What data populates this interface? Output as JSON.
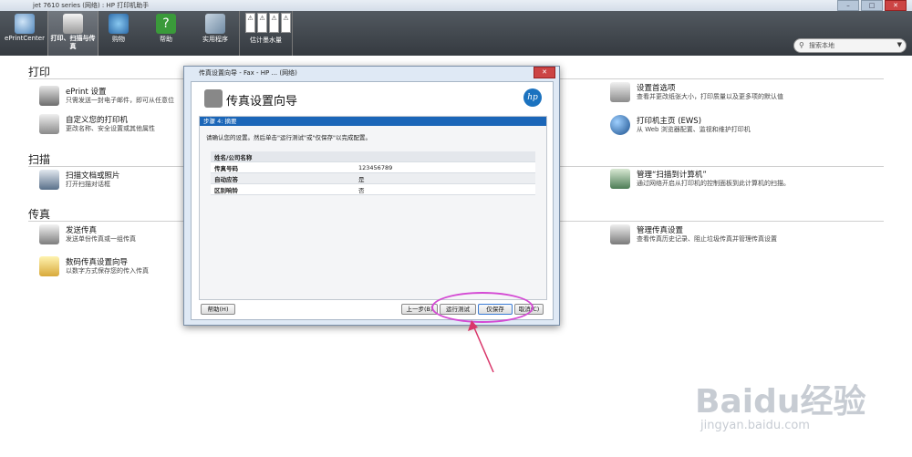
{
  "window": {
    "title": "jet 7610 series (网络) : HP 打印机助手"
  },
  "toolbar": {
    "items": [
      {
        "label": "ePrintCenter"
      },
      {
        "label": "打印、扫描与传真"
      },
      {
        "label": "购物"
      },
      {
        "label": "帮助"
      },
      {
        "label": "实用程序"
      }
    ],
    "ink_label": "估计墨水量",
    "ink_warnings": [
      "⚠",
      "⚠",
      "⚠",
      "⚠"
    ]
  },
  "search": {
    "placeholder": "搜索本地"
  },
  "sections": {
    "print": "打印",
    "scan": "扫描",
    "fax": "传真"
  },
  "items": {
    "eprint": {
      "title": "ePrint 设置",
      "desc": "只需发送一封电子邮件，即可从任意位"
    },
    "custom": {
      "title": "自定义您的打印机",
      "desc": "更改名称、安全设置或其他属性"
    },
    "pref": {
      "title": "设置首选项",
      "desc": "查看并更改纸张大小，打印质量以及更多项的默认值"
    },
    "ews": {
      "title": "打印机主页 (EWS)",
      "desc": "从 Web 浏览器配置、监视和维护打印机"
    },
    "scandoc": {
      "title": "扫描文档或照片",
      "desc": "打开扫描对话框"
    },
    "scanpc": {
      "title": "管理“扫描到计算机”",
      "desc": "通过网络开启从打印机的控制面板到此计算机的扫描。"
    },
    "sendfax": {
      "title": "发送传真",
      "desc": "发送单份传真或一组传真"
    },
    "digitalfax": {
      "title": "数码传真设置向导",
      "desc": "以数字方式保存您的传入传真"
    },
    "managefax": {
      "title": "管理传真设置",
      "desc": "查看传真历史记录、阻止垃圾传真并管理传真设置"
    }
  },
  "dialog": {
    "title": "传真设置向导 - Fax - HP ... (网络)",
    "heading": "传真设置向导",
    "step": "步骤 4: 摘要",
    "message": "请确认您的设置。然后单击\"运行测试\"或\"仅保存\"以完成配置。",
    "table_header": "姓名/公司名称",
    "rows": [
      {
        "key": "传真号码",
        "value": "123456789"
      },
      {
        "key": "自动应答",
        "value": "是"
      },
      {
        "key": "区别响铃",
        "value": "否"
      }
    ],
    "buttons": {
      "help": "帮助(H)",
      "prev": "上一步(B)",
      "run_test": "运行测试",
      "save_only": "仅保存",
      "cancel": "取消(C)"
    },
    "logo": "hp"
  },
  "watermark": {
    "brand": "Baidu经验",
    "url": "jingyan.baidu.com"
  }
}
